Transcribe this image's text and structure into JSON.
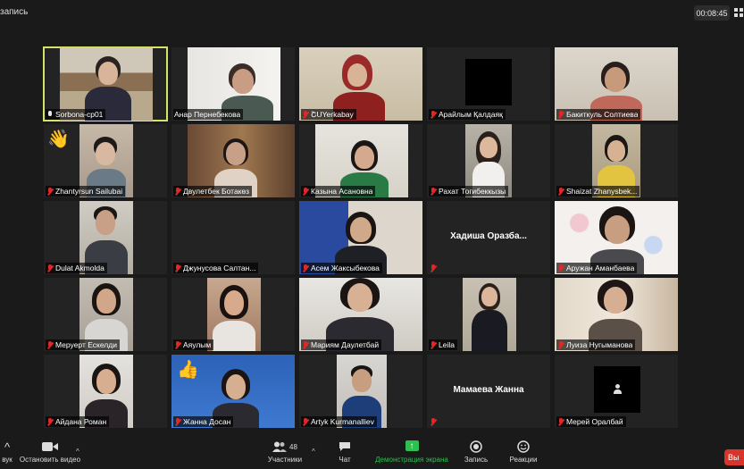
{
  "header": {
    "recording_label": "запись",
    "timer": "00:08:45"
  },
  "participants": [
    {
      "name": "Sorbona-cp01",
      "muted": false,
      "active": true
    },
    {
      "name": "Анар Пернебекова",
      "muted": false
    },
    {
      "name": "ՇՍYerkabay",
      "muted": true
    },
    {
      "name": "Арайлым Қалдаяқ",
      "muted": true
    },
    {
      "name": "Бакиткуль Солтиева",
      "muted": true
    },
    {
      "name": "Zhantyrsun Sailubai",
      "muted": true,
      "reaction": "👋"
    },
    {
      "name": "Двулетбек  Ботакөз",
      "muted": true
    },
    {
      "name": "Казына Асанoвна",
      "muted": true
    },
    {
      "name": "Рахат Тогибеккызы",
      "muted": true
    },
    {
      "name": "Shaizat Zhanysbek...",
      "muted": true
    },
    {
      "name": "Dulat Akmolda",
      "muted": true
    },
    {
      "name": "Джунусова Салтан...",
      "muted": true
    },
    {
      "name": "Асем Жаксыбекова",
      "muted": true
    },
    {
      "name": "",
      "muted": true,
      "center_name": "Хадиша  Оразба..."
    },
    {
      "name": "Аружан Аманбаева",
      "muted": true
    },
    {
      "name": "Меруерт Ескелди",
      "muted": true
    },
    {
      "name": "Аяулым",
      "muted": true
    },
    {
      "name": "Мариям Даулетбай",
      "muted": true
    },
    {
      "name": "Leila",
      "muted": true
    },
    {
      "name": "Луиза Нугыманова",
      "muted": true
    },
    {
      "name": "Айдана Роман",
      "muted": true
    },
    {
      "name": "Жанна Досан",
      "muted": true,
      "reaction": "👍"
    },
    {
      "name": "Artyk Kurmanalliev",
      "muted": true
    },
    {
      "name": "",
      "muted": true,
      "center_name": "Мамаева Жанна"
    },
    {
      "name": "Мерей Оралбай",
      "muted": true,
      "avatar": "person-icon"
    }
  ],
  "toolbar": {
    "mic_label": "вук",
    "video_label": "Остановить видео",
    "participants_label": "Участники",
    "participants_count": "48",
    "chat_label": "Чат",
    "share_label": "Демонстрация экрана",
    "record_label": "Запись",
    "reactions_label": "Реакции",
    "end_label": "Вы"
  },
  "colors": {
    "active_border": "#d6e36a",
    "muted_mic": "#e02828",
    "share_green": "#2fbf4f",
    "end_red": "#d9342b"
  }
}
